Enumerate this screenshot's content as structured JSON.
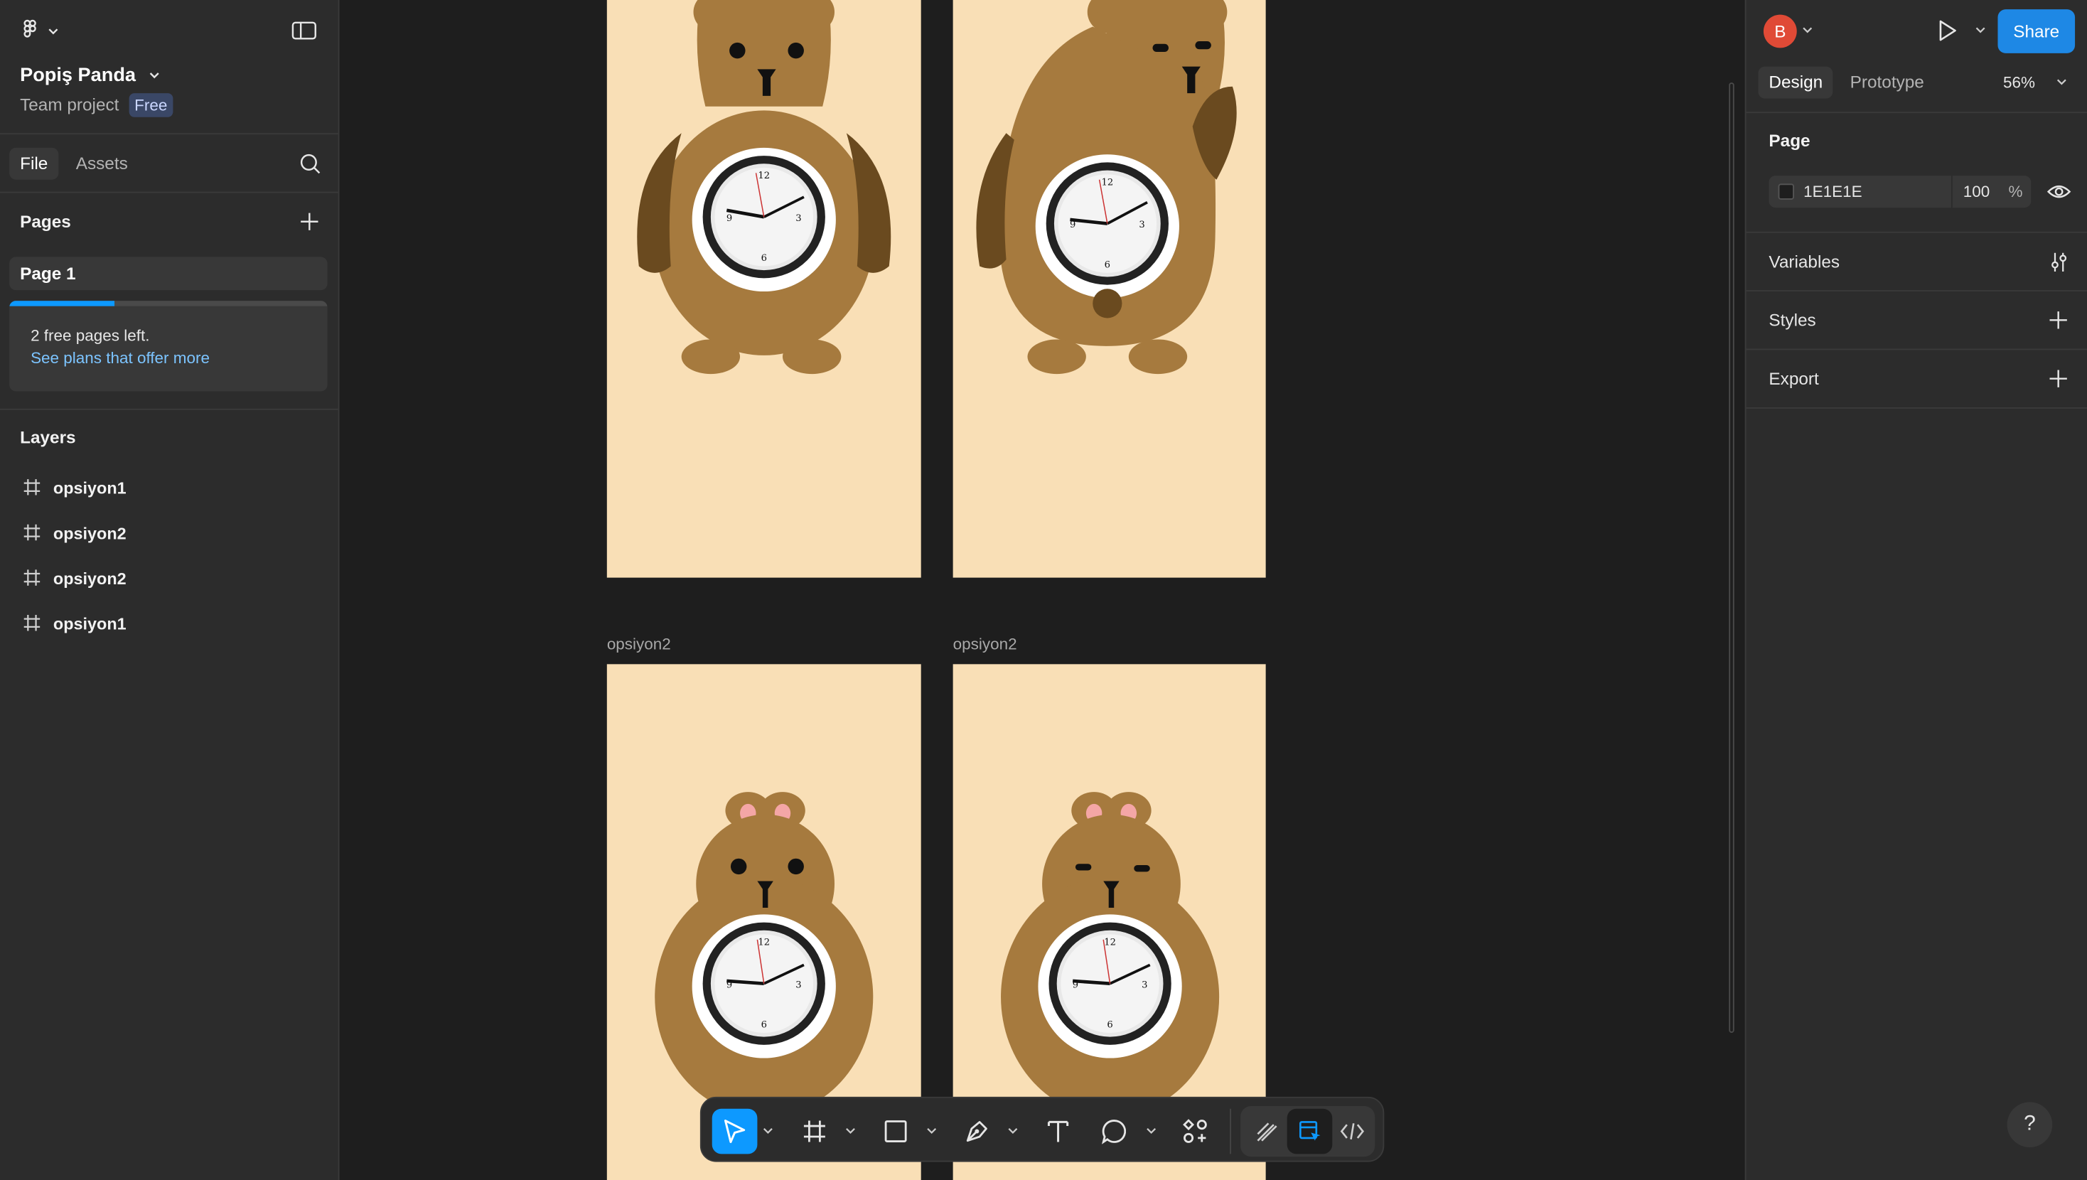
{
  "file": {
    "name": "Popiş Panda",
    "project": "Team project",
    "plan_badge": "Free"
  },
  "left_tabs": {
    "file": "File",
    "assets": "Assets"
  },
  "pages": {
    "title": "Pages",
    "items": [
      "Page 1"
    ],
    "notice_text": "2 free pages left.",
    "notice_link": "See plans that offer more",
    "usage_fraction": 0.33
  },
  "layers": {
    "title": "Layers",
    "items": [
      "opsiyon1",
      "opsiyon2",
      "opsiyon2",
      "opsiyon1"
    ]
  },
  "canvas": {
    "background": "#1E1E1E",
    "frame_fill": "#F9DFB6",
    "frame_labels": [
      "opsiyon2",
      "opsiyon2"
    ]
  },
  "header": {
    "avatar_initial": "B",
    "share_label": "Share"
  },
  "right_tabs": {
    "design": "Design",
    "prototype": "Prototype",
    "zoom": "56%"
  },
  "page_section": {
    "title": "Page",
    "color_hex": "1E1E1E",
    "opacity": "100",
    "opacity_unit": "%"
  },
  "sections": {
    "variables": "Variables",
    "styles": "Styles",
    "export": "Export"
  },
  "help_label": "?",
  "colors": {
    "accent": "#0d99ff",
    "share_button": "#1e88e5",
    "avatar": "#e04a36",
    "bear": "#a67a3e",
    "bear_arm": "#6a4a1f",
    "ear_inner": "#f4a6a6"
  }
}
